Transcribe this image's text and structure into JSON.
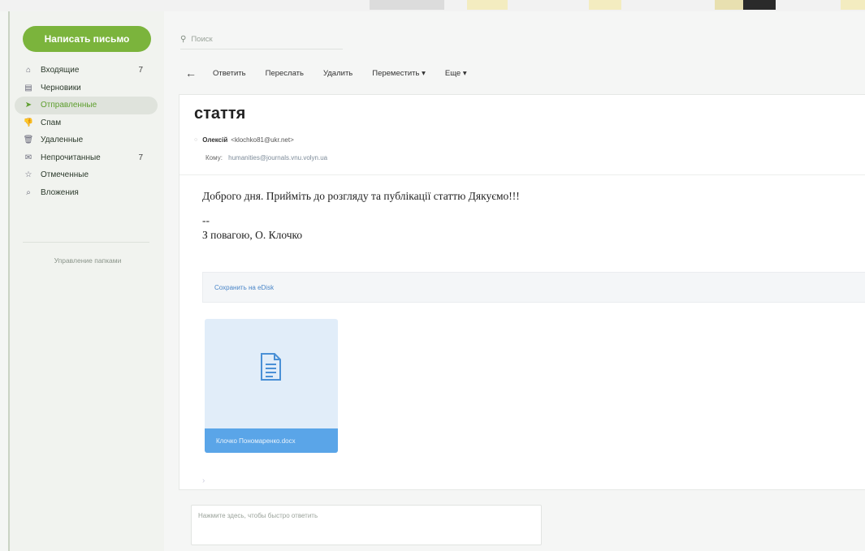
{
  "sidebar": {
    "compose_label": "Написать письмо",
    "folders": [
      {
        "label": "Входящие",
        "count": "7",
        "icon": "inbox-icon"
      },
      {
        "label": "Черновики",
        "count": "",
        "icon": "drafts-icon"
      },
      {
        "label": "Отправленные",
        "count": "",
        "icon": "sent-icon"
      },
      {
        "label": "Спам",
        "count": "",
        "icon": "spam-icon"
      },
      {
        "label": "Удаленные",
        "count": "",
        "icon": "trash-icon"
      },
      {
        "label": "Непрочитанные",
        "count": "7",
        "icon": "unread-icon"
      },
      {
        "label": "Отмеченные",
        "count": "",
        "icon": "star-icon"
      },
      {
        "label": "Вложения",
        "count": "",
        "icon": "paperclip-icon"
      }
    ],
    "active_folder": "Отправленные",
    "manage_label": "Управление папками"
  },
  "search": {
    "placeholder": "Поиск"
  },
  "toolbar": {
    "reply": "Ответить",
    "forward": "Переслать",
    "delete": "Удалить",
    "move": "Переместить ▾",
    "more": "Еще ▾"
  },
  "message": {
    "subject": "стаття",
    "from_name": "Олексій",
    "from_email": "<klochko81@ukr.net>",
    "to_label": "Кому:",
    "to_address": "humanities@journals.vnu.volyn.ua",
    "body_line1": "Доброго дня. Прийміть до розгляду та публікації статтю Дякуємо!!!",
    "body_sep": "--",
    "body_sign": "З повагою, О. Клочко",
    "save_disk": "Сохранить на eDisk",
    "attachment_name": "Клочко Пономаренко.docx"
  },
  "reply_placeholder": "Нажмите здесь, чтобы быстро ответить",
  "colors": {
    "accent": "#7bb43c",
    "attachment": "#5aa5e8"
  }
}
